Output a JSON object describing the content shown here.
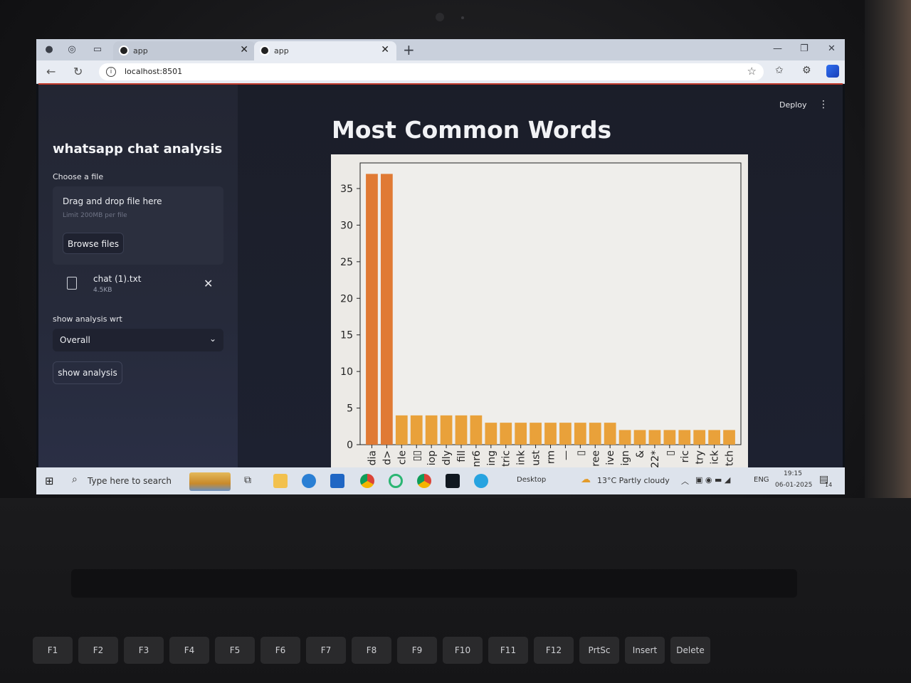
{
  "browser": {
    "tabs": [
      {
        "title": "app"
      },
      {
        "title": "app"
      }
    ],
    "url": "localhost:8501"
  },
  "sidebar": {
    "title": "whatsapp chat analysis",
    "upload_label": "Choose a file",
    "dropzone_title": "Drag and drop file here",
    "dropzone_limit": "Limit 200MB per file",
    "browse_label": "Browse files",
    "file": {
      "name": "chat (1).txt",
      "size": "4.5KB"
    },
    "select_label": "show analysis wrt",
    "select_value": "Overall",
    "show_button": "show analysis"
  },
  "header": {
    "deploy_label": "Deploy",
    "menu_icon": "kebab-menu-icon"
  },
  "main": {
    "title": "Most Common Words"
  },
  "chart_data": {
    "type": "bar",
    "orientation": "vertical",
    "bar_color": "#e9a13a",
    "first_bars_color": "#e07a34",
    "categories": [
      "dia",
      "d>",
      "cle",
      "▯▯",
      "iop",
      "dly",
      "fill",
      "nr6",
      "ing",
      "tric",
      "ink",
      "ust",
      "rm",
      "—",
      "▯",
      "ree",
      "ive",
      "ign",
      "&",
      "22*",
      "▯",
      "ric",
      "try",
      "ick",
      "tch"
    ],
    "values": [
      37,
      37,
      4,
      4,
      4,
      4,
      4,
      4,
      3,
      3,
      3,
      3,
      3,
      3,
      3,
      3,
      3,
      2,
      2,
      2,
      2,
      2,
      2,
      2,
      2
    ],
    "y_ticks": [
      0,
      5,
      10,
      15,
      20,
      25,
      30,
      35
    ],
    "ylim": [
      0,
      38.5
    ],
    "title": "",
    "xlabel": "",
    "ylabel": ""
  },
  "taskbar": {
    "search_placeholder": "Type here to search",
    "desktop_label": "Desktop",
    "weather": "13°C  Partly cloudy",
    "lang": "ENG",
    "time": "19:15",
    "date": "06-01-2025",
    "notif_count": "14"
  },
  "keyboard": {
    "keys": [
      "F1",
      "F2",
      "F3",
      "F4",
      "F5",
      "F6",
      "F7",
      "F8",
      "F9",
      "F10",
      "F11",
      "F12",
      "PrtSc",
      "Insert",
      "Delete"
    ]
  }
}
